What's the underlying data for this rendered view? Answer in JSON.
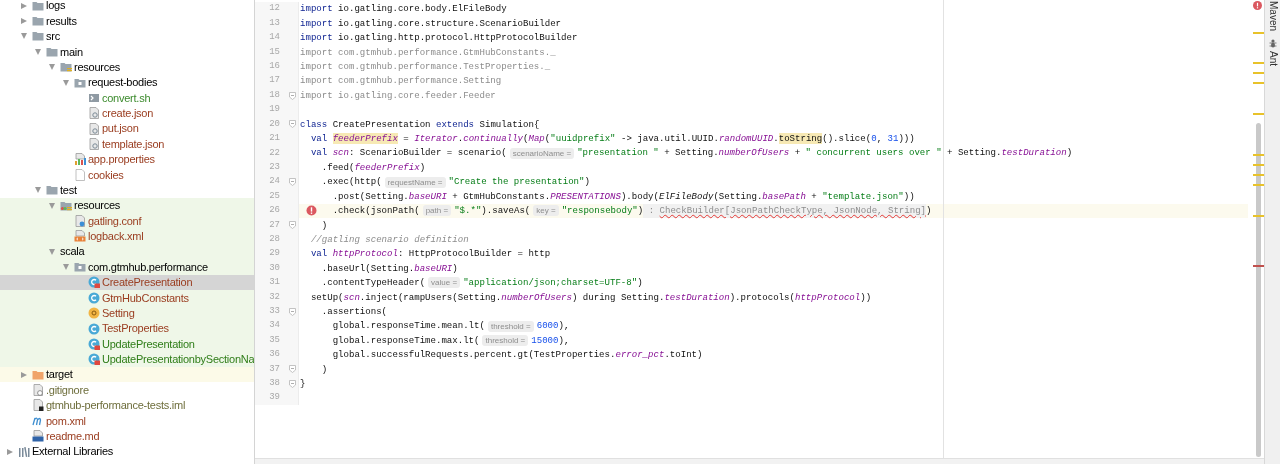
{
  "tree": [
    {
      "label": "logs",
      "kind": "folder",
      "expanded": false,
      "selected": false
    },
    {
      "label": "results",
      "kind": "folder",
      "expanded": false,
      "selected": false
    },
    {
      "label": "src",
      "kind": "folder",
      "expanded": true,
      "selected": false,
      "children": [
        {
          "label": "main",
          "kind": "folder",
          "expanded": true,
          "selected": false,
          "children": [
            {
              "label": "resources",
              "kind": "resources",
              "expanded": true,
              "selected": false,
              "children": [
                {
                  "label": "request-bodies",
                  "kind": "package",
                  "expanded": true,
                  "selected": false,
                  "children": [
                    {
                      "label": "convert.sh",
                      "kind": "shell",
                      "selected": false,
                      "color": "#3b8a2c"
                    },
                    {
                      "label": "create.json",
                      "kind": "json",
                      "selected": false,
                      "color": "#9a3d20"
                    },
                    {
                      "label": "put.json",
                      "kind": "json",
                      "selected": false,
                      "color": "#9a3d20"
                    },
                    {
                      "label": "template.json",
                      "kind": "json",
                      "selected": false,
                      "color": "#9a3d20"
                    }
                  ]
                },
                {
                  "label": "app.properties",
                  "kind": "properties",
                  "selected": false,
                  "color": "#9a3d20"
                },
                {
                  "label": "cookies",
                  "kind": "text",
                  "selected": false,
                  "color": "#9a3d20"
                }
              ]
            }
          ]
        },
        {
          "label": "test",
          "kind": "folder",
          "expanded": true,
          "selected": false,
          "children": [
            {
              "label": "resources",
              "kind": "testresources",
              "expanded": true,
              "selected": false,
              "children": [
                {
                  "label": "gatling.conf",
                  "kind": "conf",
                  "selected": false,
                  "color": "#9a3d20"
                },
                {
                  "label": "logback.xml",
                  "kind": "xml",
                  "selected": false,
                  "color": "#9a3d20"
                }
              ]
            },
            {
              "label": "scala",
              "kind": "testsource",
              "expanded": true,
              "selected": false,
              "children": [
                {
                  "label": "com.gtmhub.performance",
                  "kind": "package",
                  "expanded": true,
                  "selected": false,
                  "children": [
                    {
                      "label": "CreatePresentation",
                      "kind": "runnable",
                      "selected": true,
                      "color": "#9a3d20"
                    },
                    {
                      "label": "GtmHubConstants",
                      "kind": "class",
                      "selected": false,
                      "color": "#9a3d20"
                    },
                    {
                      "label": "Setting",
                      "kind": "object",
                      "selected": false,
                      "color": "#9a3d20"
                    },
                    {
                      "label": "TestProperties",
                      "kind": "class",
                      "selected": false,
                      "color": "#9a3d20"
                    },
                    {
                      "label": "UpdatePresentation",
                      "kind": "runnable",
                      "selected": false,
                      "color": "#2f7d18"
                    },
                    {
                      "label": "UpdatePresentationbySectionNa",
                      "kind": "runnable",
                      "selected": false,
                      "color": "#2f7d18"
                    }
                  ]
                }
              ]
            }
          ]
        }
      ]
    },
    {
      "label": "target",
      "kind": "excluded",
      "expanded": false,
      "selected": false
    },
    {
      "label": ".gitignore",
      "kind": "gitignore",
      "selected": false,
      "color": "#6e6e3c"
    },
    {
      "label": "gtmhub-performance-tests.iml",
      "kind": "iml",
      "selected": false,
      "color": "#6e6e3c"
    },
    {
      "label": "pom.xml",
      "kind": "maven",
      "selected": false,
      "color": "#9a3d20"
    },
    {
      "label": "readme.md",
      "kind": "markdown",
      "selected": false,
      "color": "#9a3d20"
    }
  ],
  "external_libraries": {
    "label": "External Libraries",
    "expanded": false,
    "selected": false
  },
  "lines": [
    {
      "number": "12",
      "current": false,
      "fold": false,
      "error": false,
      "tokens": [
        {
          "kind": "keyword",
          "text": "import"
        },
        {
          "kind": "plain",
          "text": " io.gatling.core.body.ElFileBody"
        }
      ]
    },
    {
      "number": "13",
      "current": false,
      "fold": false,
      "error": false,
      "tokens": [
        {
          "kind": "keyword",
          "text": "import"
        },
        {
          "kind": "plain",
          "text": " io.gatling.core.structure.ScenarioBuilder"
        }
      ]
    },
    {
      "number": "14",
      "current": false,
      "fold": false,
      "error": false,
      "tokens": [
        {
          "kind": "keyword",
          "text": "import"
        },
        {
          "kind": "plain",
          "text": " io.gatling.http.protocol.HttpProtocolBuilder"
        }
      ]
    },
    {
      "number": "15",
      "current": false,
      "fold": false,
      "error": false,
      "tokens": [
        {
          "kind": "unused",
          "text": "import com.gtmhub.performance.GtmHubConstants._"
        }
      ]
    },
    {
      "number": "16",
      "current": false,
      "fold": false,
      "error": false,
      "tokens": [
        {
          "kind": "unused",
          "text": "import com.gtmhub.performance.TestProperties._"
        }
      ]
    },
    {
      "number": "17",
      "current": false,
      "fold": false,
      "error": false,
      "tokens": [
        {
          "kind": "unused",
          "text": "import com.gtmhub.performance.Setting"
        }
      ]
    },
    {
      "number": "18",
      "current": false,
      "fold": true,
      "error": false,
      "tokens": [
        {
          "kind": "unused",
          "text": "import io.gatling.core.feeder.Feeder"
        }
      ]
    },
    {
      "number": "19",
      "current": false,
      "fold": false,
      "error": false
    },
    {
      "number": "20",
      "current": false,
      "fold": true,
      "error": false,
      "tokens": [
        {
          "kind": "keyword",
          "text": "class"
        },
        {
          "kind": "plain",
          "text": " CreatePresentation "
        },
        {
          "kind": "keyword",
          "text": "extends"
        },
        {
          "kind": "plain",
          "text": " Simulation{"
        }
      ]
    },
    {
      "number": "21",
      "current": false,
      "fold": false,
      "error": false,
      "tokens": [
        {
          "kind": "keyword",
          "text": "  val "
        },
        {
          "kind": "fieldmark",
          "text": "feederPrefix"
        },
        {
          "kind": "plain",
          "text": " = "
        },
        {
          "kind": "field",
          "text": "Iterator"
        },
        {
          "kind": "plain",
          "text": "."
        },
        {
          "kind": "field",
          "text": "continually"
        },
        {
          "kind": "plain",
          "text": "("
        },
        {
          "kind": "field",
          "text": "Map"
        },
        {
          "kind": "plain",
          "text": "("
        },
        {
          "kind": "string",
          "text": "\"uuidprefix\""
        },
        {
          "kind": "plain",
          "text": " -> java.util.UUID."
        },
        {
          "kind": "field",
          "text": "randomUUID"
        },
        {
          "kind": "plain",
          "text": "."
        },
        {
          "kind": "textmark",
          "text": "toString"
        },
        {
          "kind": "plain",
          "text": "().slice("
        },
        {
          "kind": "number",
          "text": "0"
        },
        {
          "kind": "plain",
          "text": ", "
        },
        {
          "kind": "number",
          "text": "31"
        },
        {
          "kind": "plain",
          "text": ")))"
        }
      ]
    },
    {
      "number": "22",
      "current": false,
      "fold": false,
      "error": false,
      "tokens": [
        {
          "kind": "keyword",
          "text": "  val "
        },
        {
          "kind": "field",
          "text": "scn"
        },
        {
          "kind": "plain",
          "text": ": ScenarioBuilder = scenario("
        },
        {
          "kind": "hint",
          "text": "scenarioName ="
        },
        {
          "kind": "string",
          "text": "\"presentation \""
        },
        {
          "kind": "plain",
          "text": " + Setting."
        },
        {
          "kind": "field",
          "text": "numberOfUsers"
        },
        {
          "kind": "plain",
          "text": " + "
        },
        {
          "kind": "string",
          "text": "\" concurrent users over \""
        },
        {
          "kind": "plain",
          "text": " + Setting."
        },
        {
          "kind": "field",
          "text": "testDuration"
        },
        {
          "kind": "plain",
          "text": ")"
        }
      ]
    },
    {
      "number": "23",
      "current": false,
      "fold": false,
      "error": false,
      "tokens": [
        {
          "kind": "plain",
          "text": "    .feed("
        },
        {
          "kind": "field",
          "text": "feederPrefix"
        },
        {
          "kind": "plain",
          "text": ")"
        }
      ]
    },
    {
      "number": "24",
      "current": false,
      "fold": true,
      "error": false,
      "tokens": [
        {
          "kind": "plain",
          "text": "    .exec(http("
        },
        {
          "kind": "hint",
          "text": "requestName ="
        },
        {
          "kind": "string",
          "text": "\"Create the presentation\""
        },
        {
          "kind": "plain",
          "text": ")"
        }
      ]
    },
    {
      "number": "25",
      "current": false,
      "fold": false,
      "error": false,
      "tokens": [
        {
          "kind": "plain",
          "text": "      .post(Setting."
        },
        {
          "kind": "field",
          "text": "baseURI"
        },
        {
          "kind": "plain",
          "text": " + GtmHubConstants."
        },
        {
          "kind": "field",
          "text": "PRESENTATIONS"
        },
        {
          "kind": "plain",
          "text": ").body("
        },
        {
          "kind": "static",
          "text": "ElFileBody"
        },
        {
          "kind": "plain",
          "text": "(Setting."
        },
        {
          "kind": "field",
          "text": "basePath"
        },
        {
          "kind": "plain",
          "text": " + "
        },
        {
          "kind": "string",
          "text": "\"template.json\""
        },
        {
          "kind": "plain",
          "text": "))"
        }
      ]
    },
    {
      "number": "26",
      "current": true,
      "fold": false,
      "error": true,
      "tokens": [
        {
          "kind": "plain",
          "text": "      .check(jsonPath("
        },
        {
          "kind": "hint",
          "text": "path ="
        },
        {
          "kind": "string",
          "text": "\"$.*\""
        },
        {
          "kind": "plain",
          "text": ").saveAs("
        },
        {
          "kind": "hint",
          "text": "key ="
        },
        {
          "kind": "string",
          "text": "\"responsebody\""
        },
        {
          "kind": "plain",
          "text": ")"
        },
        {
          "kind": "typehint",
          "prefix": " : ",
          "text": "CheckBuilder[JsonPathCheckType, JsonNode, String]",
          "error": true
        },
        {
          "kind": "plain",
          "text": ")"
        }
      ]
    },
    {
      "number": "27",
      "current": false,
      "fold": true,
      "error": false,
      "tokens": [
        {
          "kind": "plain",
          "text": "    )"
        }
      ]
    },
    {
      "number": "28",
      "current": false,
      "fold": false,
      "error": false,
      "tokens": [
        {
          "kind": "comment",
          "text": "  //gatling scenario definition"
        }
      ]
    },
    {
      "number": "29",
      "current": false,
      "fold": false,
      "error": false,
      "tokens": [
        {
          "kind": "keyword",
          "text": "  val "
        },
        {
          "kind": "field",
          "text": "httpProtocol"
        },
        {
          "kind": "plain",
          "text": ": HttpProtocolBuilder = http"
        }
      ]
    },
    {
      "number": "30",
      "current": false,
      "fold": false,
      "error": false,
      "tokens": [
        {
          "kind": "plain",
          "text": "    .baseUrl(Setting."
        },
        {
          "kind": "field",
          "text": "baseURI"
        },
        {
          "kind": "plain",
          "text": ")"
        }
      ]
    },
    {
      "number": "31",
      "current": false,
      "fold": false,
      "error": false,
      "tokens": [
        {
          "kind": "plain",
          "text": "    .contentTypeHeader("
        },
        {
          "kind": "hint",
          "text": "value ="
        },
        {
          "kind": "string",
          "text": "\"application/json;charset=UTF-8\""
        },
        {
          "kind": "plain",
          "text": ")"
        }
      ]
    },
    {
      "number": "32",
      "current": false,
      "fold": false,
      "error": false,
      "tokens": [
        {
          "kind": "plain",
          "text": "  setUp("
        },
        {
          "kind": "field",
          "text": "scn"
        },
        {
          "kind": "plain",
          "text": ".inject(rampUsers(Setting."
        },
        {
          "kind": "field",
          "text": "numberOfUsers"
        },
        {
          "kind": "plain",
          "text": ") during Setting."
        },
        {
          "kind": "field",
          "text": "testDuration"
        },
        {
          "kind": "plain",
          "text": ").protocols("
        },
        {
          "kind": "field",
          "text": "httpProtocol"
        },
        {
          "kind": "plain",
          "text": "))"
        }
      ]
    },
    {
      "number": "33",
      "current": false,
      "fold": true,
      "error": false,
      "tokens": [
        {
          "kind": "plain",
          "text": "    .assertions("
        }
      ]
    },
    {
      "number": "34",
      "current": false,
      "fold": false,
      "error": false,
      "tokens": [
        {
          "kind": "plain",
          "text": "      global.responseTime.mean.lt("
        },
        {
          "kind": "hint",
          "text": "threshold ="
        },
        {
          "kind": "number",
          "text": "6000"
        },
        {
          "kind": "plain",
          "text": "),"
        }
      ]
    },
    {
      "number": "35",
      "current": false,
      "fold": false,
      "error": false,
      "tokens": [
        {
          "kind": "plain",
          "text": "      global.responseTime.max.lt("
        },
        {
          "kind": "hint",
          "text": "threshold ="
        },
        {
          "kind": "number",
          "text": "15000"
        },
        {
          "kind": "plain",
          "text": "),"
        }
      ]
    },
    {
      "number": "36",
      "current": false,
      "fold": false,
      "error": false,
      "tokens": [
        {
          "kind": "plain",
          "text": "      global.successfulRequests.percent.gt(TestProperties."
        },
        {
          "kind": "field",
          "text": "error_pct"
        },
        {
          "kind": "plain",
          "text": ".toInt)"
        }
      ]
    },
    {
      "number": "37",
      "current": false,
      "fold": true,
      "error": false,
      "tokens": [
        {
          "kind": "plain",
          "text": "    )"
        }
      ]
    },
    {
      "number": "38",
      "current": false,
      "fold": true,
      "error": false,
      "tokens": [
        {
          "kind": "plain",
          "text": "}"
        }
      ]
    },
    {
      "number": "39",
      "current": false,
      "fold": false,
      "error": false
    }
  ],
  "tool_windows": [
    {
      "label": "Maven",
      "kind": "plain"
    },
    {
      "label": "Ant",
      "kind": "ant"
    }
  ]
}
